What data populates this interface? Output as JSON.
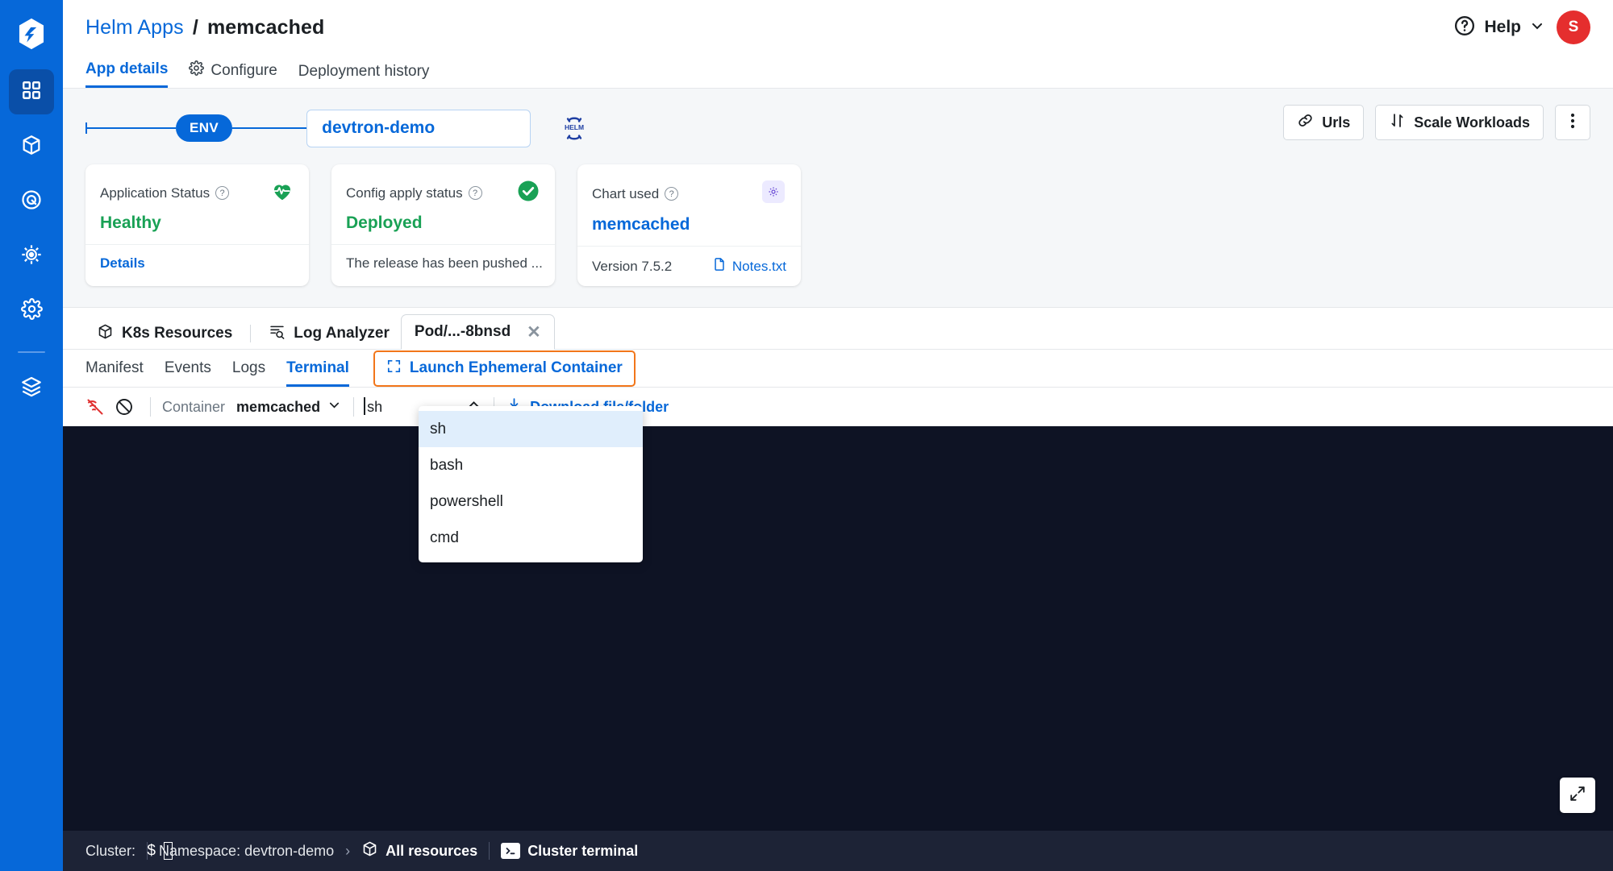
{
  "rail": {
    "logo": "devtron-logo",
    "items": [
      {
        "name": "applications",
        "icon": "grid-icon",
        "active": true
      },
      {
        "name": "charts",
        "icon": "cube-icon",
        "active": false
      },
      {
        "name": "security",
        "icon": "target-icon",
        "active": false
      },
      {
        "name": "bulk-edit",
        "icon": "helm-wheel-icon",
        "active": false
      },
      {
        "name": "global-config",
        "icon": "gear-icon",
        "active": false
      },
      {
        "name": "stack-manager",
        "icon": "layers-icon",
        "active": false
      }
    ]
  },
  "header": {
    "breadcrumb_parent": "Helm Apps",
    "breadcrumb_sep": "/",
    "breadcrumb_current": "memcached",
    "help_label": "Help",
    "avatar_initial": "S"
  },
  "main_tabs": [
    {
      "label": "App details",
      "icon": null,
      "active": true
    },
    {
      "label": "Configure",
      "icon": "gear-icon",
      "active": false
    },
    {
      "label": "Deployment history",
      "icon": null,
      "active": false
    }
  ],
  "env": {
    "pill_label": "ENV",
    "name": "devtron-demo",
    "helm_badge": "HELM"
  },
  "toolbar": {
    "urls_label": "Urls",
    "scale_label": "Scale Workloads",
    "more_label": "more-options"
  },
  "cards": [
    {
      "title": "Application Status",
      "value": "Healthy",
      "value_color": "#19a155",
      "icon": "heartbeat-icon",
      "footer": "Details",
      "footer_is_link": true
    },
    {
      "title": "Config apply status",
      "value": "Deployed",
      "value_color": "#19a155",
      "icon": "check-circle-icon",
      "footer": "The release has been pushed ...",
      "footer_is_link": false
    },
    {
      "title": "Chart used",
      "value": "memcached",
      "value_color": "#0668d9",
      "icon": "chart-gear-icon",
      "footer": "Version 7.5.2",
      "footer_link": "Notes.txt",
      "footer_is_link": false
    }
  ],
  "resource_tabs": [
    {
      "label": "K8s Resources",
      "icon": "cube-icon",
      "type": "plain"
    },
    {
      "label": "Log Analyzer",
      "icon": "log-search-icon",
      "type": "plain"
    },
    {
      "label": "Pod/...-8bnsd",
      "icon": null,
      "type": "chip",
      "closable": true
    }
  ],
  "sub_tabs": [
    {
      "label": "Manifest",
      "active": false
    },
    {
      "label": "Events",
      "active": false
    },
    {
      "label": "Logs",
      "active": false
    },
    {
      "label": "Terminal",
      "active": true
    }
  ],
  "launch_ephemeral": {
    "label": "Launch Ephemeral Container",
    "icon": "bracket-frame-icon",
    "highlight_color": "#f2761a"
  },
  "terminal_toolbar": {
    "clear_icon": "clear-terminal-icon",
    "disconnect_icon": "disconnect-icon",
    "container_label": "Container",
    "container_value": "memcached",
    "shell_value": "sh",
    "download_label": "Download file/folder",
    "download_icon": "download-icon"
  },
  "shell_dropdown": {
    "open": true,
    "options": [
      "sh",
      "bash",
      "powershell",
      "cmd"
    ],
    "selected": "sh"
  },
  "terminal": {
    "prompt_symbol": "$",
    "cursor": "block"
  },
  "statusbar": {
    "cluster_label": "Cluster:",
    "namespace_label": "Namespace: devtron-demo",
    "chevron": "›",
    "all_resources": "All resources",
    "cluster_terminal": "Cluster terminal",
    "terminal_badge": "⌫"
  }
}
